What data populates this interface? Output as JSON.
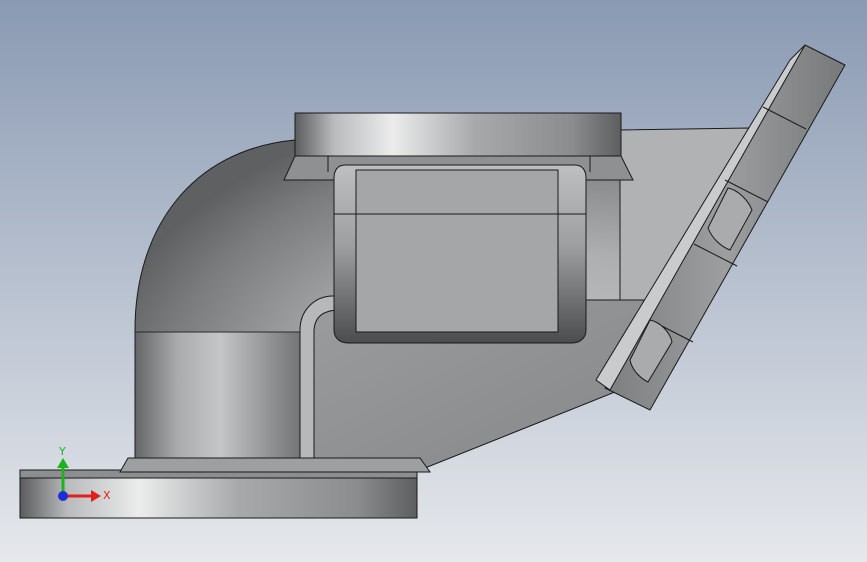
{
  "viewport": {
    "background_top": "#8a9ab3",
    "background_bottom": "#e6e8ec"
  },
  "model": {
    "type": "cast elbow manifold with flanges",
    "body_color": "#8e9092",
    "edge_color": "#1a1a1a"
  },
  "triad": {
    "x_label": "X",
    "y_label": "Y",
    "x_color": "#e0201c",
    "y_color": "#1fb21f",
    "z_color": "#1a2fd8"
  }
}
